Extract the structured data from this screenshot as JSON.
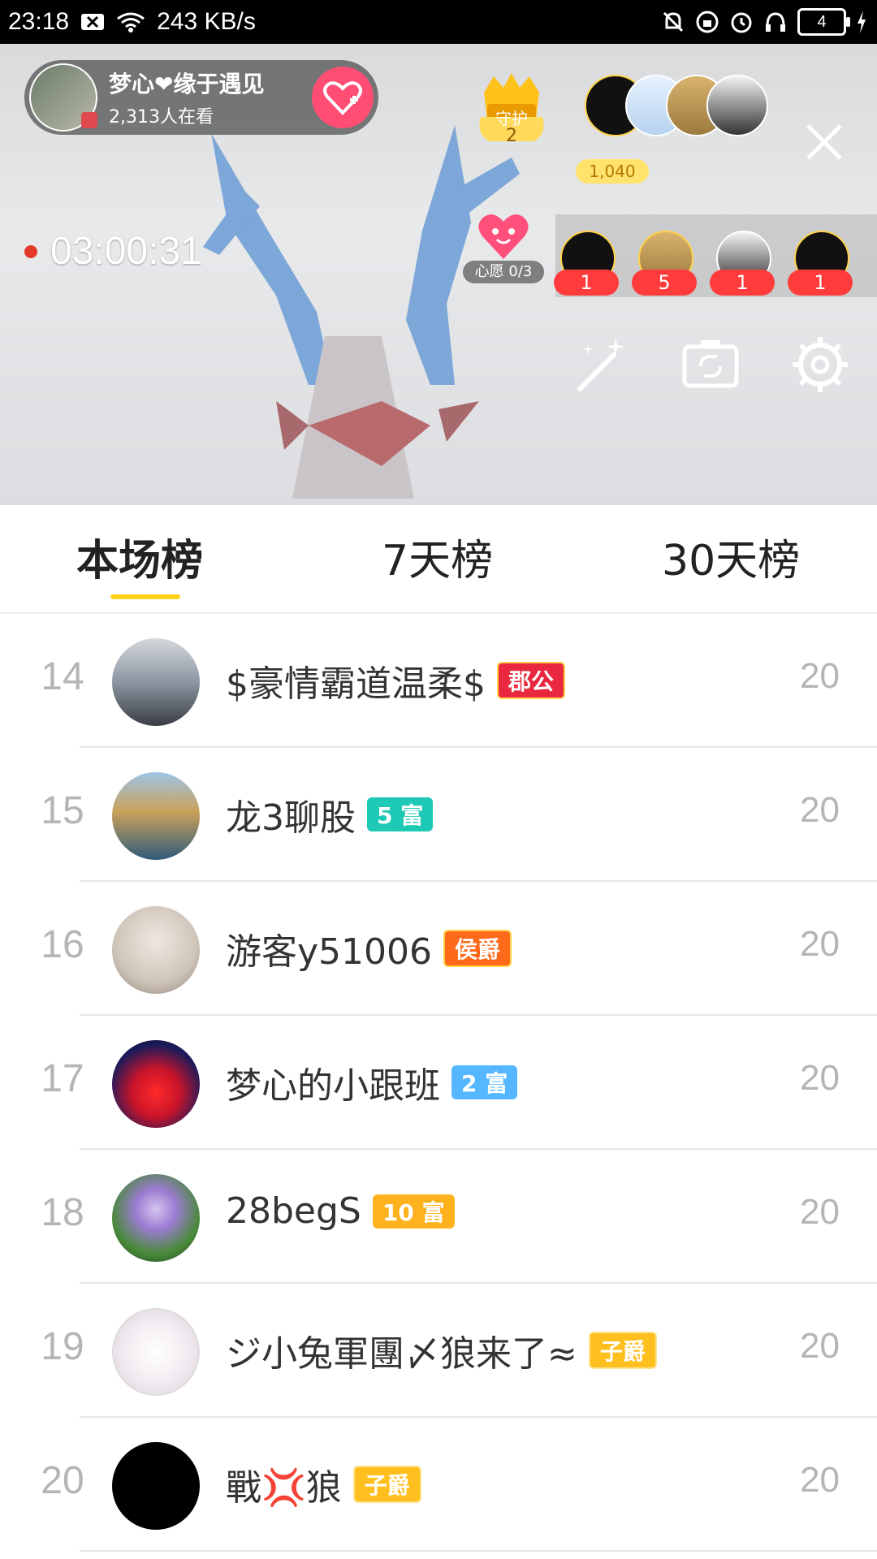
{
  "status_bar": {
    "time": "23:18",
    "net_speed": "243 KB/s",
    "battery": "4"
  },
  "live": {
    "host_name": "梦心❤缘于遇见",
    "viewers": "2,313人在看",
    "guard_label": "守护",
    "guard_count": "2",
    "coin_count": "1,040",
    "timer": "03:00:31",
    "wish_label": "心愿 0/3",
    "rank_counts": [
      "1",
      "5",
      "1",
      "1"
    ]
  },
  "tabs": {
    "current": "本场榜",
    "week": "7天榜",
    "month": "30天榜"
  },
  "rows": [
    {
      "rank": "14",
      "name": "$豪情霸道温柔$",
      "badge": "郡公",
      "score": "20",
      "color": "#e9283f"
    },
    {
      "rank": "15",
      "name": "龙3聊股",
      "badge": "5 富",
      "score": "20",
      "color": "#1ec9b5"
    },
    {
      "rank": "16",
      "name": "游客y51006",
      "badge": "侯爵",
      "score": "20",
      "color": "#ff6a1a"
    },
    {
      "rank": "17",
      "name": "梦心的小跟班",
      "badge": "2 富",
      "score": "20",
      "color": "#55b7ff"
    },
    {
      "rank": "18",
      "name": "28begS",
      "badge": "10 富",
      "score": "20",
      "color": "#ffb11e"
    },
    {
      "rank": "19",
      "name": "ジ小兔軍團〆狼来了≈",
      "badge": "子爵",
      "score": "20",
      "color": "#ffbf1f"
    },
    {
      "rank": "20",
      "name": "戰💢狼",
      "badge": "子爵",
      "score": "20",
      "color": "#ffbf1f"
    }
  ]
}
